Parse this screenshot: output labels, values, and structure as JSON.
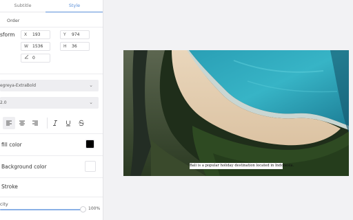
{
  "tabs": {
    "subtitle": "Subtitle",
    "style": "Style"
  },
  "order_label": "Order",
  "transform": {
    "label": "sform",
    "x_label": "X",
    "x_value": "193",
    "y_label": "Y",
    "y_value": "974",
    "w_label": "W",
    "w_value": "1536",
    "h_label": "H",
    "h_value": "36",
    "rotation_value": "0"
  },
  "font_family": "egreya-ExtraBold",
  "font_size": "2.0",
  "fill_color": {
    "label": "fill color",
    "value": "#000000"
  },
  "background_color": {
    "label": "Background color",
    "value": "#ffffff"
  },
  "stroke_label": "Stroke",
  "opacity": {
    "label": "city",
    "value_text": "100%",
    "level": 1.0
  },
  "subtitle_text": "Bali is a popular holiday destination located in Indonesia.",
  "accent_color": "#5a8fd8"
}
